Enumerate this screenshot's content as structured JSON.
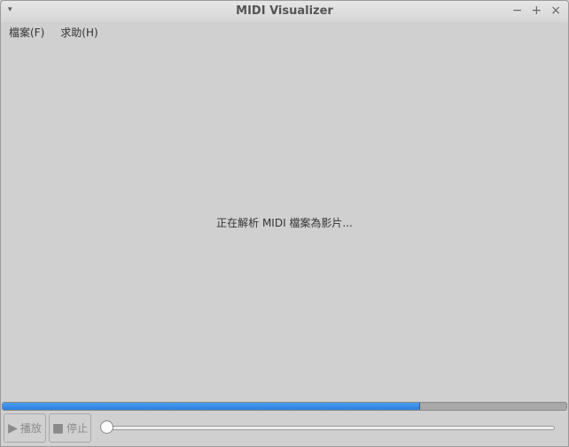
{
  "window": {
    "title": "MIDI Visualizer",
    "menu_icon": "▾",
    "minimize": "−",
    "maximize": "+",
    "close": "×"
  },
  "menu": [
    "檔案(F)",
    "求助(H)"
  ],
  "status_text": "正在解析 MIDI 檔案為影片...",
  "progress": 0.74,
  "controls": {
    "play_label": "播放",
    "play_icon": "▶",
    "stop_label": "停止",
    "stop_icon": "■",
    "seek_position": 0
  }
}
